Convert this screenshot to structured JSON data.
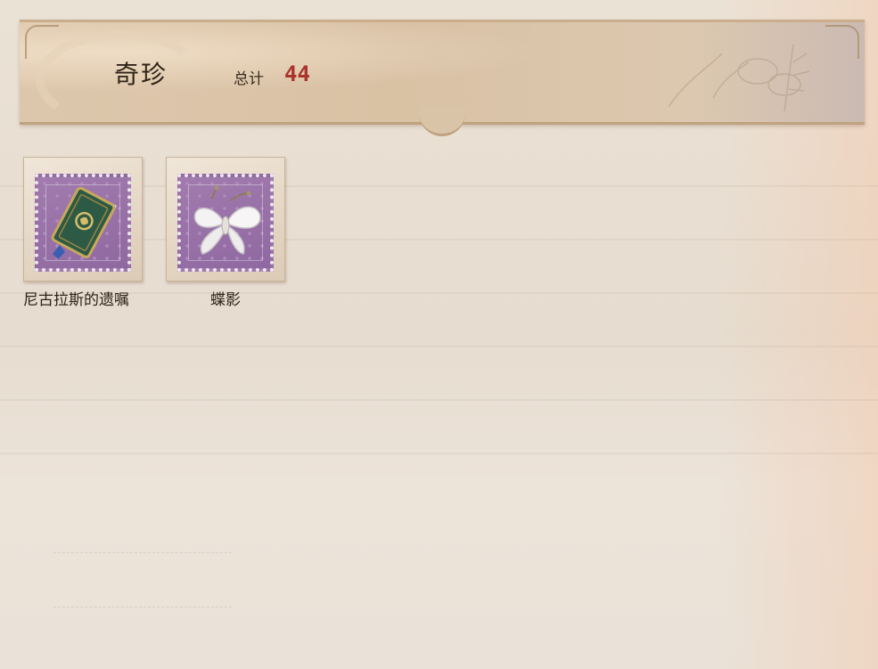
{
  "header": {
    "title": "奇珍",
    "total_label": "总计",
    "total_value": "44"
  },
  "items": [
    {
      "name": "尼古拉斯的遗嘱",
      "icon": "green-book-icon"
    },
    {
      "name": "蝶影",
      "icon": "white-butterfly-icon"
    }
  ],
  "colors": {
    "background": "#e8dfd3",
    "header": "#d9c1a4",
    "total_value": "#a8342c",
    "stamp": "#9a74a8"
  }
}
